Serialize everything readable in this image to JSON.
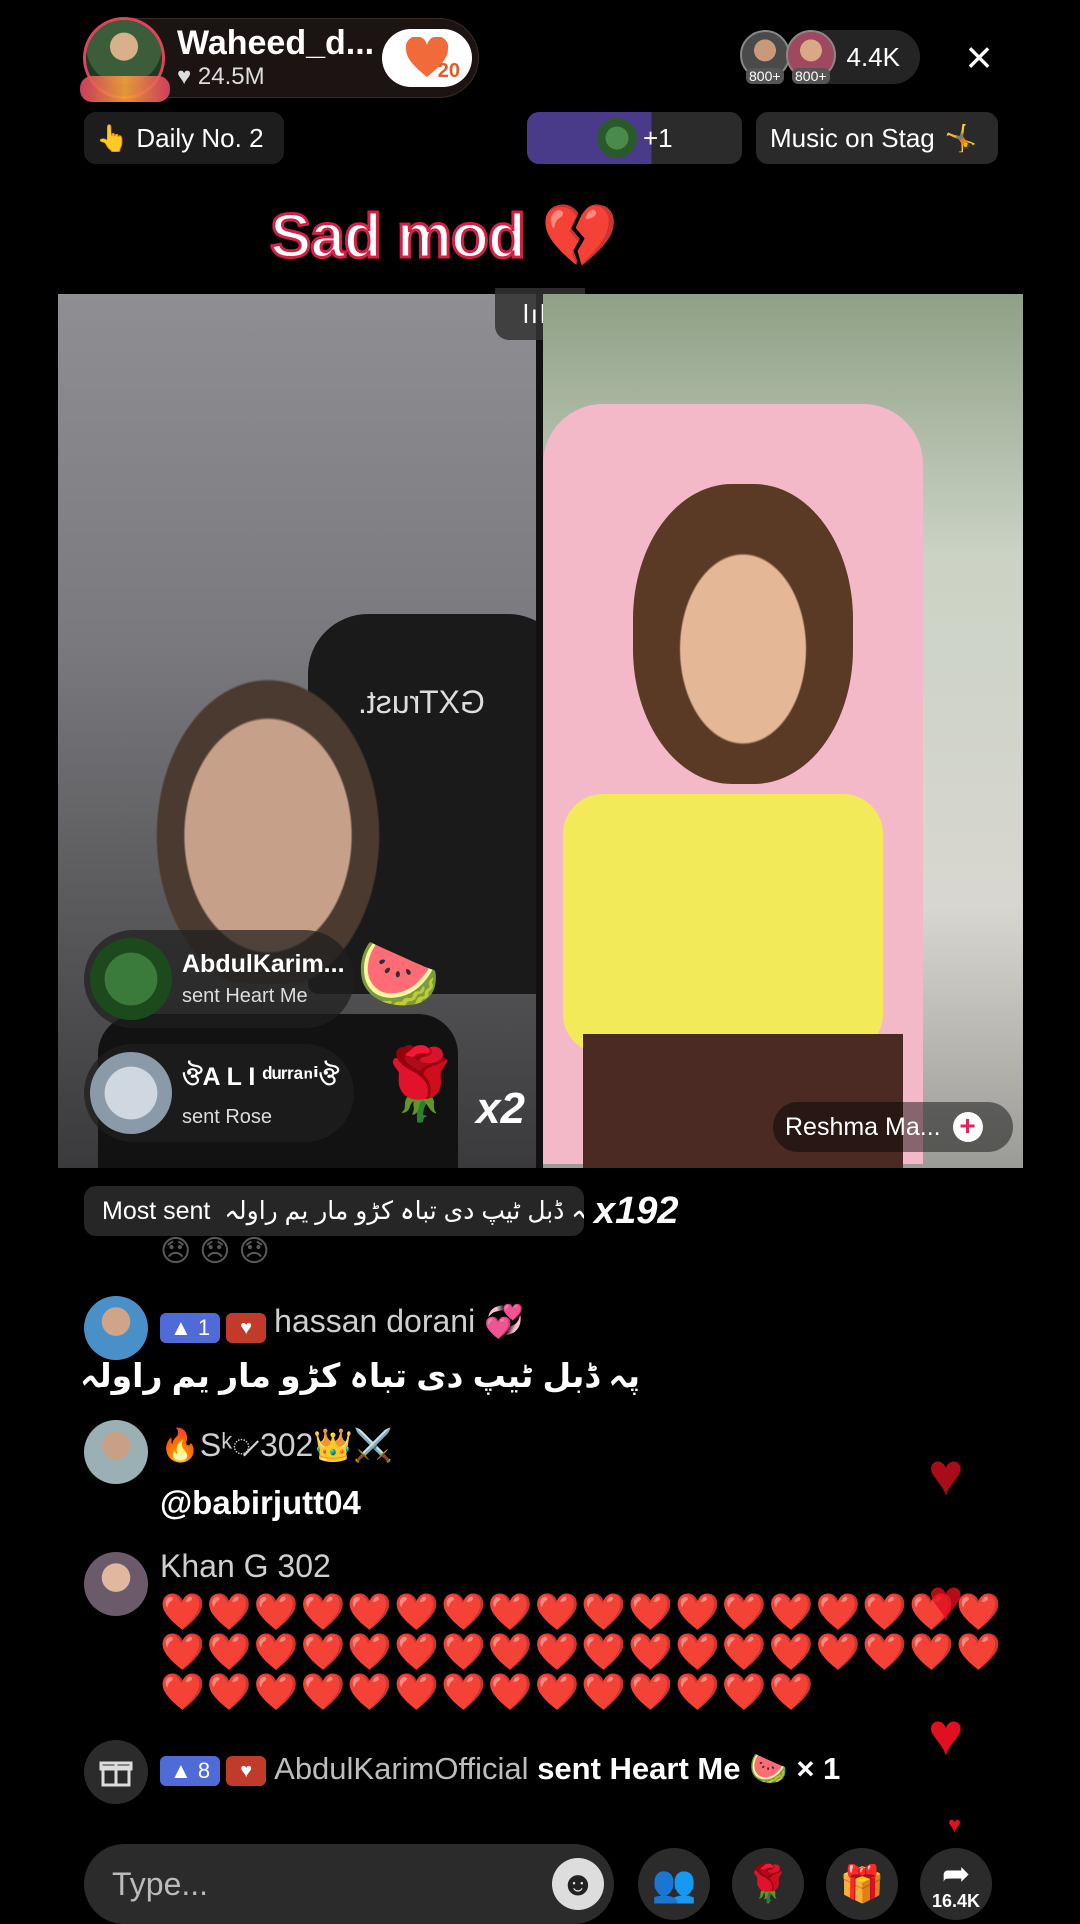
{
  "header": {
    "host_name": "Waheed_d...",
    "host_likes": "24.5M",
    "follow_badge_count": "20",
    "viewer_badges": [
      "800+",
      "800+"
    ],
    "viewer_count": "4.4K",
    "close_symbol": "×"
  },
  "chips": {
    "daily": "Daily No. 2",
    "guests": "+1",
    "music": "Music on Stag"
  },
  "stream_title": "Sad mod 💔",
  "video": {
    "handle_glyph": "lılı",
    "chair_brand": "GXTrust.",
    "right_name": "Reshma Ma...",
    "right_add": "+"
  },
  "gifts": [
    {
      "name": "AbdulKarim...",
      "action": "sent Heart Me",
      "multiplier": ""
    },
    {
      "name": "ঔA L I ᵈᵘʳʳᵃⁿⁱঔ",
      "action": "sent Rose",
      "multiplier": "x2"
    }
  ],
  "most_sent": {
    "label": "Most sent",
    "text": "پہ ڈبل ٹیپ دی تباہ کڑو مار یم راولہ",
    "multiplier": "x192"
  },
  "comments": [
    {
      "level": "1",
      "name": "hassan dorani 💞",
      "text": "پہ ڈبل ٹیپ دی تباہ کڑو مار یم راولہ"
    },
    {
      "level": "",
      "name": "🔥Sᵏ◌̷ 302👑⚔️",
      "text": "@babirjutt04"
    },
    {
      "level": "",
      "name": "Khan G 302",
      "hearts": [
        "❤️❤️❤️❤️❤️❤️❤️❤️❤️❤️❤️❤️❤️❤️❤️❤️❤️❤️",
        "❤️❤️❤️❤️❤️❤️❤️❤️❤️❤️❤️❤️❤️❤️❤️❤️❤️❤️",
        "❤️❤️❤️❤️❤️❤️❤️❤️❤️❤️❤️❤️❤️❤️"
      ]
    }
  ],
  "gift_notice": {
    "level": "8",
    "name": "AbdulKarimOfficial",
    "action": "sent Heart Me",
    "count": "× 1"
  },
  "bottom_bar": {
    "placeholder": "Type...",
    "share_count": "16.4K"
  },
  "colors": {
    "title_stroke": "#d42045",
    "level_badge": "#4f6bd8",
    "heart": "#e01020"
  }
}
